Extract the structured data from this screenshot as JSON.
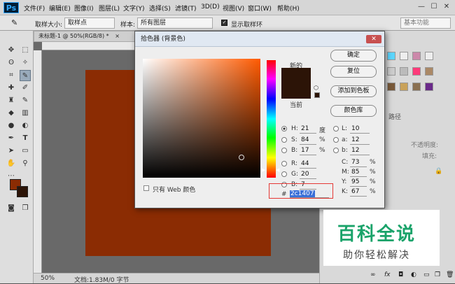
{
  "app": {
    "logo": "Ps"
  },
  "menu": [
    "文件(F)",
    "编辑(E)",
    "图像(I)",
    "图层(L)",
    "文字(Y)",
    "选择(S)",
    "滤镜(T)",
    "3D(D)",
    "视图(V)",
    "窗口(W)",
    "帮助(H)"
  ],
  "window_buttons": [
    "—",
    "☐",
    "✕"
  ],
  "options": {
    "sample_size_label": "取样大小:",
    "sample_size_value": "取样点",
    "sample_label": "样本:",
    "sample_value": "所有图层",
    "show_ring_label": "显示取样环",
    "workspace": "基本功能"
  },
  "document": {
    "tab_title": "未标题-1 @ 50%(RGB/8) *",
    "close": "×",
    "zoom": "50%",
    "doc_info": "文档:1.83M/0 字节",
    "canvas_color": "#8b2c03"
  },
  "dialog": {
    "title": "拾色器 (背景色)",
    "close": "✕",
    "new_label": "新的",
    "current_label": "当前",
    "new_color": "#2c1407",
    "current_color": "#2c1407",
    "buttons": {
      "ok": "确定",
      "reset": "复位",
      "add_swatch": "添加到色板",
      "color_libs": "颜色库"
    },
    "hsb": [
      {
        "label": "H:",
        "value": "21",
        "unit": "度"
      },
      {
        "label": "S:",
        "value": "84",
        "unit": "%"
      },
      {
        "label": "B:",
        "value": "17",
        "unit": "%"
      }
    ],
    "rgb": [
      {
        "label": "R:",
        "value": "44"
      },
      {
        "label": "G:",
        "value": "20"
      },
      {
        "label": "B:",
        "value": "7"
      }
    ],
    "lab": [
      {
        "label": "L:",
        "value": "10"
      },
      {
        "label": "a:",
        "value": "12"
      },
      {
        "label": "b:",
        "value": "12"
      }
    ],
    "cmyk": [
      {
        "label": "C:",
        "value": "73",
        "unit": "%"
      },
      {
        "label": "M:",
        "value": "85",
        "unit": "%"
      },
      {
        "label": "Y:",
        "value": "95",
        "unit": "%"
      },
      {
        "label": "K:",
        "value": "67",
        "unit": "%"
      }
    ],
    "web_only_label": "只有 Web 颜色",
    "hex_label": "#",
    "hex_value": "2c1407"
  },
  "panels": {
    "tab_label": "路径",
    "opacity_label": "不透明度:",
    "fill_label": "填充:"
  },
  "watermark": {
    "title": "百科全说",
    "subtitle": "助你轻松解决"
  }
}
